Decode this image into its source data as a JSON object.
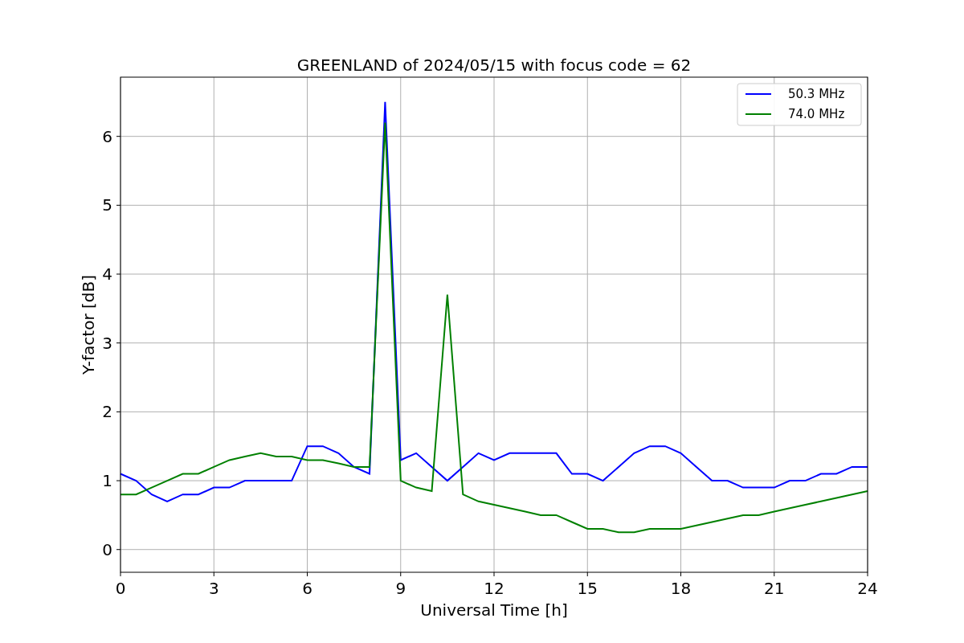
{
  "chart_data": {
    "type": "line",
    "title": "GREENLAND of 2024/05/15 with focus code = 62",
    "xlabel": "Universal Time [h]",
    "ylabel": "Y-factor [dB]",
    "x": [
      0,
      0.5,
      1,
      1.5,
      2,
      2.5,
      3,
      3.5,
      4,
      4.5,
      5,
      5.5,
      6,
      6.5,
      7,
      7.5,
      8,
      8.5,
      9,
      9.5,
      10,
      10.5,
      11,
      11.5,
      12,
      12.5,
      13,
      13.5,
      14,
      14.5,
      15,
      15.5,
      16,
      16.5,
      17,
      17.5,
      18,
      18.5,
      19,
      19.5,
      20,
      20.5,
      21,
      21.5,
      22,
      22.5,
      23,
      23.5,
      24
    ],
    "series": [
      {
        "name": "50.3 MHz",
        "color": "#0000ff",
        "values": [
          1.1,
          1.0,
          0.8,
          0.7,
          0.8,
          0.8,
          0.9,
          0.9,
          1.0,
          1.0,
          1.0,
          1.0,
          1.5,
          1.5,
          1.4,
          1.2,
          1.1,
          6.5,
          1.3,
          1.4,
          1.2,
          1.0,
          1.2,
          1.4,
          1.3,
          1.4,
          1.4,
          1.4,
          1.4,
          1.1,
          1.1,
          1.0,
          1.2,
          1.4,
          1.5,
          1.5,
          1.4,
          1.2,
          1.0,
          1.0,
          0.9,
          0.9,
          0.9,
          1.0,
          1.0,
          1.1,
          1.1,
          1.2,
          1.2
        ]
      },
      {
        "name": "74.0 MHz",
        "color": "#008000",
        "values": [
          0.8,
          0.8,
          0.9,
          1.0,
          1.1,
          1.1,
          1.2,
          1.3,
          1.35,
          1.4,
          1.35,
          1.35,
          1.3,
          1.3,
          1.25,
          1.2,
          1.2,
          6.2,
          1.0,
          0.9,
          0.85,
          3.7,
          0.8,
          0.7,
          0.65,
          0.6,
          0.55,
          0.5,
          0.5,
          0.4,
          0.3,
          0.3,
          0.25,
          0.25,
          0.3,
          0.3,
          0.3,
          0.35,
          0.4,
          0.45,
          0.5,
          0.5,
          0.55,
          0.6,
          0.65,
          0.7,
          0.75,
          0.8,
          0.85
        ]
      }
    ],
    "grid": true,
    "legend": true,
    "xlim": [
      0,
      24
    ],
    "ylim": [
      -0.33,
      6.86
    ],
    "xticks": [
      0,
      3,
      6,
      9,
      12,
      15,
      18,
      21,
      24
    ],
    "yticks": [
      0,
      1,
      2,
      3,
      4,
      5,
      6
    ]
  }
}
